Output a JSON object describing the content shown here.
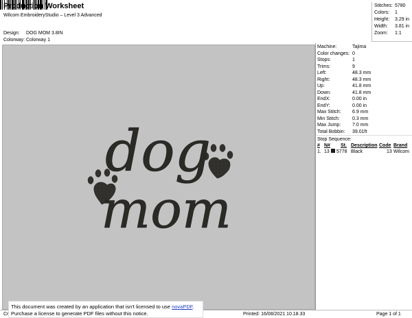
{
  "header": {
    "title": "Production Worksheet",
    "subtitle": "Wilcom EmbroideryStudio – Level 3 Advanced",
    "design_label": "Design:",
    "design_value": "DOG MOM 3.8IN",
    "colorway_label": "Colorway:",
    "colorway_value": "Colorway 1"
  },
  "summary": {
    "stitches_label": "Stitches:",
    "stitches_value": "5780",
    "colors_label": "Colors:",
    "colors_value": "1",
    "height_label": "Height:",
    "height_value": "3.29 in",
    "width_label": "Width:",
    "width_value": "3.81 in",
    "zoom_label": "Zoom:",
    "zoom_value": "1:1"
  },
  "machine_info": [
    {
      "label": "Machine:",
      "value": "Tajima"
    },
    {
      "label": "Color changes:",
      "value": "0"
    },
    {
      "label": "Stops:",
      "value": "1"
    },
    {
      "label": "Trims:",
      "value": "9"
    },
    {
      "label": "Left:",
      "value": "48.3 mm"
    },
    {
      "label": "Right:",
      "value": "48.3 mm"
    },
    {
      "label": "Up:",
      "value": "41.8 mm"
    },
    {
      "label": "Down:",
      "value": "41.8 mm"
    },
    {
      "label": "EndX:",
      "value": "0.00 in"
    },
    {
      "label": "EndY:",
      "value": "0.00 in"
    },
    {
      "label": "Max Stitch:",
      "value": "6.9 mm"
    },
    {
      "label": "Min Stitch:",
      "value": "0.3 mm"
    },
    {
      "label": "Max Jump:",
      "value": "7.0 mm"
    },
    {
      "label": "Total Bobbin:",
      "value": "39.01ft"
    }
  ],
  "stop_sequence": {
    "title": "Stop Sequence:",
    "headers": {
      "num": "#",
      "n": "N#",
      "st": "St.",
      "description": "Description",
      "code": "Code",
      "brand": "Brand"
    },
    "rows": [
      {
        "num": "1.",
        "n": "13",
        "st": "5778",
        "description": "Black",
        "code": "13",
        "brand": "Wilcom",
        "swatch_color": "#1a1a1a"
      }
    ]
  },
  "design_artwork": {
    "word1": "dog",
    "word2": "mom",
    "thread_color": "#2b2a27",
    "background_color": "#c3c3c3"
  },
  "footer": {
    "left": "Cr",
    "printed": "Printed: 16/08/2021 10.18.33",
    "page": "Page 1 of 1"
  },
  "notice": {
    "line1_prefix": "This document was created by an application that isn't licensed to use ",
    "link": "novaPDF",
    "line1_suffix": ".",
    "line2": "Purchase a license to generate PDF files without this notice."
  }
}
